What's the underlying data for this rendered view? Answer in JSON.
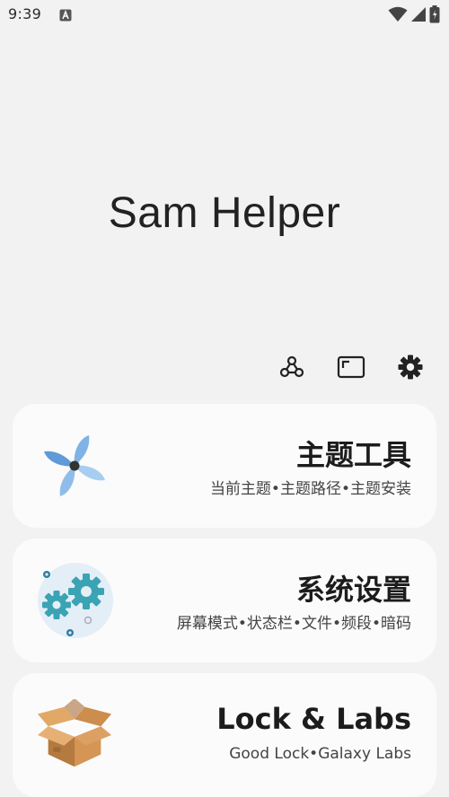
{
  "status_bar": {
    "time": "9:39",
    "notification_icon": "a-square-icon",
    "icons": [
      "wifi-icon",
      "cell-signal-icon",
      "battery-icon"
    ]
  },
  "app": {
    "title": "Sam Helper"
  },
  "toolbar": {
    "icons": [
      "molecule-icon",
      "window-icon",
      "gear-icon"
    ]
  },
  "cards": [
    {
      "title": "主题工具",
      "subtitle": "当前主题•主题路径•主题安装",
      "icon": "pinwheel-icon"
    },
    {
      "title": "系统设置",
      "subtitle": "屏幕模式•状态栏•文件•频段•暗码",
      "icon": "gears-icon"
    },
    {
      "title": "Lock & Labs",
      "subtitle": "Good Lock•Galaxy Labs",
      "icon": "box-icon"
    }
  ],
  "colors": {
    "background": "#f2f2f2",
    "card": "#fbfbfb",
    "gear_teal": "#3aa3b4",
    "pinwheel_blue": "#6fa8de",
    "box_brown": "#c98a4b"
  }
}
